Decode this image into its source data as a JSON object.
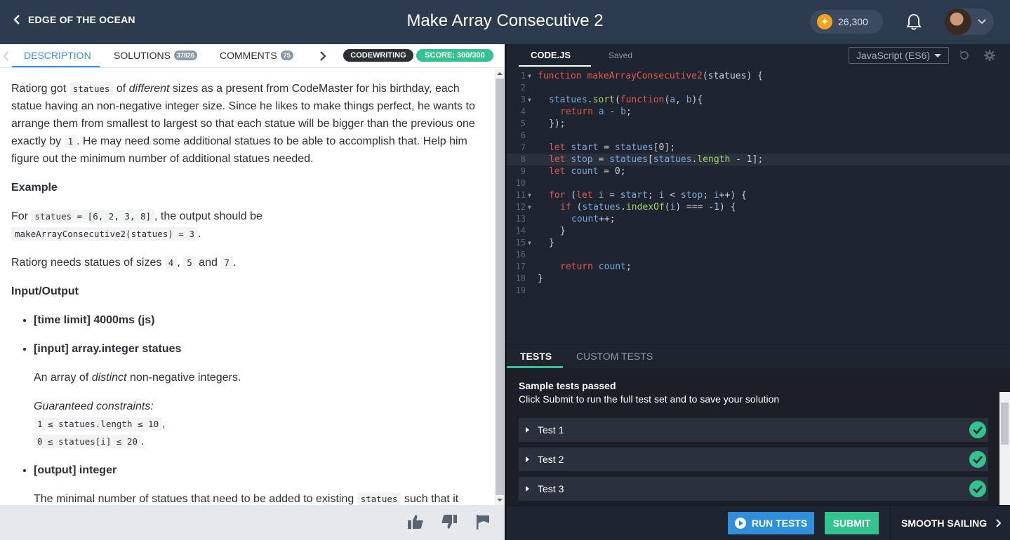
{
  "header": {
    "back_label": "EDGE OF THE OCEAN",
    "title": "Make Array Consecutive 2",
    "coins": "26,300"
  },
  "left_tabs": {
    "description": "DESCRIPTION",
    "solutions": "SOLUTIONS",
    "solutions_count": "37826",
    "comments": "COMMENTS",
    "comments_count": "75",
    "mode_badge": "CODEWRITING",
    "score_badge": "SCORE: 300/300"
  },
  "description": {
    "p1_a": "Ratiorg got ",
    "p1_code": "statues",
    "p1_b": " of ",
    "p1_em": "different",
    "p1_c": " sizes as a present from CodeMaster for his birthday, each statue having an non-negative integer size. Since he likes to make things perfect, he wants to arrange them from smallest to largest so that each statue will be bigger than the previous one exactly by ",
    "p1_code2": "1",
    "p1_d": ". He may need some additional statues to be able to accomplish that. Help him figure out the minimum number of additional statues needed.",
    "example_heading": "Example",
    "ex_a": "For ",
    "ex_code1": "statues = [6, 2, 3, 8]",
    "ex_b": ", the output should be",
    "ex_code2": "makeArrayConsecutive2(statues) = 3",
    "ex_c": ".",
    "needs_a": "Ratiorg needs statues of sizes ",
    "needs_c1": "4",
    "needs_sep1": ", ",
    "needs_c2": "5",
    "needs_and": " and ",
    "needs_c3": "7",
    "needs_end": ".",
    "io_heading": "Input/Output",
    "io_time": "[time limit] 4000ms (js)",
    "io_input": "[input] array.integer statues",
    "io_input_a": "An array of ",
    "io_input_em": "distinct",
    "io_input_b": " non-negative integers.",
    "constraints_label": "Guaranteed constraints:",
    "constraint1": "1 ≤ statues.length ≤ 10",
    "constraint1_end": ",",
    "constraint2": "0 ≤ statues[i] ≤ 20",
    "constraint2_end": ".",
    "io_output": "[output] integer",
    "out_a": "The minimal number of statues that need to be added to existing ",
    "out_code": "statues",
    "out_b": " such that it"
  },
  "editor": {
    "file_tab": "CODE.JS",
    "saved": "Saved",
    "language": "JavaScript (ES6)",
    "lines": [
      {
        "n": "1",
        "fold": true
      },
      {
        "n": "2"
      },
      {
        "n": "3",
        "fold": true
      },
      {
        "n": "4"
      },
      {
        "n": "5"
      },
      {
        "n": "6"
      },
      {
        "n": "7"
      },
      {
        "n": "8",
        "highlight": true
      },
      {
        "n": "9"
      },
      {
        "n": "10"
      },
      {
        "n": "11",
        "fold": true
      },
      {
        "n": "12",
        "fold": true
      },
      {
        "n": "13"
      },
      {
        "n": "14"
      },
      {
        "n": "15",
        "fold": true
      },
      {
        "n": "16"
      },
      {
        "n": "17"
      },
      {
        "n": "18"
      },
      {
        "n": "19"
      }
    ],
    "code": {
      "l1_kw": "function",
      "l1_fn": "makeArrayConsecutive2",
      "l1_rest": "(statues) {",
      "l3_a": "statues",
      "l3_m": "sort",
      "l3_kw": "function",
      "l3_args_a": "a",
      "l3_args_b": "b",
      "l4_kw": "return",
      "l4_a": "a",
      "l4_b": "b",
      "l5": "});",
      "l7_kw": "let",
      "l7_var": "start",
      "l7_src": "statues",
      "l7_idx": "[0];",
      "l8_kw": "let",
      "l8_var": "stop",
      "l8_src": "statues",
      "l8_src2": "statues",
      "l8_m": "length",
      "l8_end": " - 1];",
      "l9_kw": "let",
      "l9_var": "count",
      "l9_end": " = 0;",
      "l11_kw": "for",
      "l11_let": "let",
      "l11_i": "i",
      "l11_start": "start",
      "l11_i2": "i",
      "l11_stop": "stop",
      "l11_i3": "i",
      "l12_kw": "if",
      "l12_src": "statues",
      "l12_m": "indexOf",
      "l12_i": "i",
      "l12_end": ") === -1) {",
      "l13_var": "count",
      "l13_end": "++;",
      "l14": "}",
      "l15": "}",
      "l17_kw": "return",
      "l17_var": "count",
      "l18": "}"
    }
  },
  "tests": {
    "tab_tests": "TESTS",
    "tab_custom": "CUSTOM TESTS",
    "status_title": "Sample tests passed",
    "status_detail": "Click Submit to run the full test set and to save your solution",
    "items": [
      {
        "name": "Test 1",
        "passed": true
      },
      {
        "name": "Test 2",
        "passed": true
      },
      {
        "name": "Test 3",
        "passed": true
      }
    ]
  },
  "footer": {
    "run_tests": "RUN TESTS",
    "submit": "SUBMIT",
    "next": "SMOOTH SAILING"
  },
  "colors": {
    "topbar": "#2d3b4e",
    "accent_blue": "#3a8fd9",
    "accent_green": "#34c28f",
    "editor_bg": "#1f2530"
  }
}
